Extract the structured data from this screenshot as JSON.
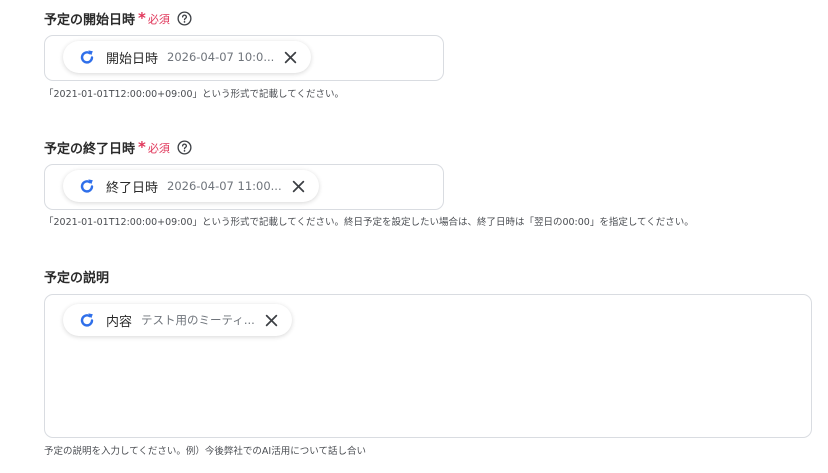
{
  "fields": [
    {
      "label": "予定の開始日時",
      "required_mark": "*",
      "required_text": "必須",
      "chip": {
        "label": "開始日時",
        "value": "2026-04-07 10:0..."
      },
      "hint": "「2021-01-01T12:00:00+09:00」という形式で記載してください。"
    },
    {
      "label": "予定の終了日時",
      "required_mark": "*",
      "required_text": "必須",
      "chip": {
        "label": "終了日時",
        "value": "2026-04-07 11:00..."
      },
      "hint": "「2021-01-01T12:00:00+09:00」という形式で記載してください。終日予定を設定したい場合は、終了日時は「翌日の00:00」を指定してください。"
    },
    {
      "label": "予定の説明",
      "chip": {
        "label": "内容",
        "value": "テスト用のミーティ..."
      },
      "hint": "予定の説明を入力してください。例）今後弊社でのAI活用について話し合い"
    }
  ],
  "icons": {
    "help": "question-circle-icon",
    "chip": "refresh-arrow-icon",
    "close": "close-icon"
  },
  "colors": {
    "required": "#e0365a",
    "chip_icon": "#2f6fea",
    "border": "#d9dce1"
  }
}
